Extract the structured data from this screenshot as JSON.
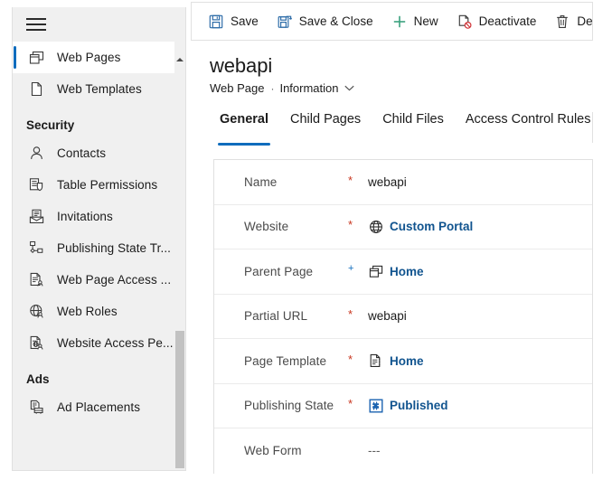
{
  "sidebar": {
    "menu_icon": "hamburger-icon",
    "items": [
      {
        "type": "item",
        "label": "Web Pages",
        "icon": "web-pages-icon",
        "selected": true
      },
      {
        "type": "item",
        "label": "Web Templates",
        "icon": "web-templates-icon",
        "selected": false
      },
      {
        "type": "group",
        "label": "Security"
      },
      {
        "type": "item",
        "label": "Contacts",
        "icon": "contact-icon",
        "selected": false
      },
      {
        "type": "item",
        "label": "Table  Permissions",
        "icon": "table-permissions-icon",
        "selected": false
      },
      {
        "type": "item",
        "label": "Invitations",
        "icon": "invitations-icon",
        "selected": false
      },
      {
        "type": "item",
        "label": "Publishing State Tr...",
        "icon": "publishing-state-transition-icon",
        "selected": false
      },
      {
        "type": "item",
        "label": "Web Page Access ...",
        "icon": "web-page-access-icon",
        "selected": false
      },
      {
        "type": "item",
        "label": "Web Roles",
        "icon": "web-roles-icon",
        "selected": false
      },
      {
        "type": "item",
        "label": "Website Access Pe...",
        "icon": "website-access-icon",
        "selected": false
      },
      {
        "type": "group",
        "label": "Ads"
      },
      {
        "type": "item",
        "label": "Ad Placements",
        "icon": "ad-placements-icon",
        "selected": false
      }
    ]
  },
  "commandbar": {
    "commands": [
      {
        "label": "Save",
        "icon": "save-icon"
      },
      {
        "label": "Save & Close",
        "icon": "save-and-close-icon"
      },
      {
        "label": "New",
        "icon": "plus-icon"
      },
      {
        "label": "Deactivate",
        "icon": "deactivate-icon"
      },
      {
        "label": "Del",
        "icon": "delete-trash-icon"
      }
    ]
  },
  "record": {
    "title": "webapi",
    "entity": "Web Page",
    "separator": "·",
    "form": "Information",
    "form_chevron": "chevron-down-icon"
  },
  "tabs": [
    {
      "label": "General",
      "active": true
    },
    {
      "label": "Child Pages",
      "active": false
    },
    {
      "label": "Child Files",
      "active": false
    },
    {
      "label": "Access Control Rules",
      "active": false
    }
  ],
  "fields": [
    {
      "label": "Name",
      "required": "required",
      "marker": "*",
      "value": "webapi",
      "icon": null,
      "kind": "plain"
    },
    {
      "label": "Website",
      "required": "required",
      "marker": "*",
      "value": "Custom Portal",
      "icon": "globe-icon",
      "kind": "link"
    },
    {
      "label": "Parent Page",
      "required": "recommended",
      "marker": "+",
      "value": "Home",
      "icon": "web-pages-icon",
      "kind": "link"
    },
    {
      "label": "Partial URL",
      "required": "required",
      "marker": "*",
      "value": "webapi",
      "icon": null,
      "kind": "plain"
    },
    {
      "label": "Page Template",
      "required": "required",
      "marker": "*",
      "value": "Home",
      "icon": "page-template-icon",
      "kind": "link"
    },
    {
      "label": "Publishing State",
      "required": "required",
      "marker": "*",
      "value": "Published",
      "icon": "publishing-state-icon",
      "kind": "link"
    },
    {
      "label": "Web Form",
      "required": "none",
      "marker": "",
      "value": "---",
      "icon": null,
      "kind": "empty"
    }
  ],
  "colors": {
    "accent_blue": "#0f6cbd",
    "link_blue": "#11548f",
    "required_red": "#c8361f",
    "new_green": "#3aa17e",
    "deactivate_red": "#d13438",
    "sidebar_bg": "#f0f0f0",
    "border": "#e0e0e0"
  }
}
